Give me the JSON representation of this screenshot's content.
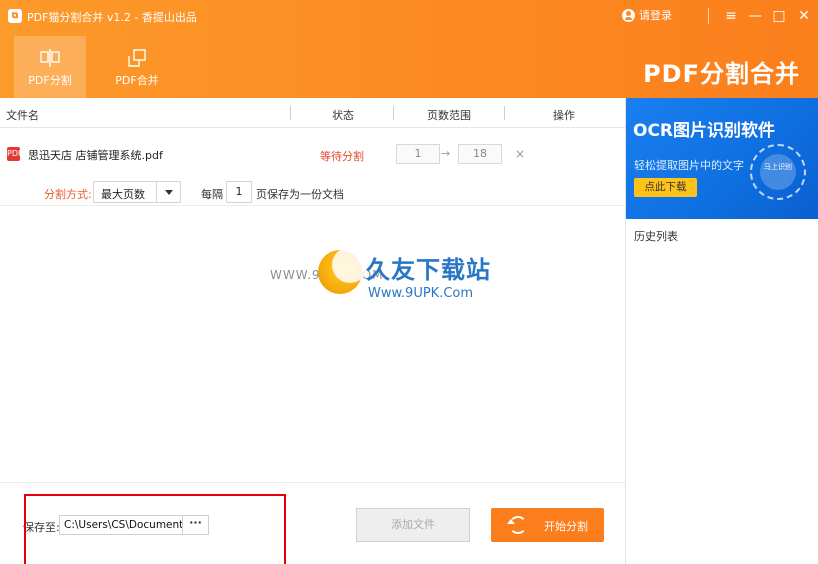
{
  "app": {
    "title": "PDF猫分割合并 v1.2 - 香提山出品",
    "icon_glyph": "⧉",
    "login": "请登录",
    "brand": "PDF分割合并"
  },
  "window_controls": {
    "menu": "≡",
    "minimize": "—",
    "maximize": "□",
    "close": "✕"
  },
  "tabs": [
    {
      "label": "PDF分割",
      "icon": "split-icon",
      "active": true
    },
    {
      "label": "PDF合并",
      "icon": "merge-icon",
      "active": false
    }
  ],
  "table": {
    "headers": {
      "name": "文件名",
      "status": "状态",
      "range": "页数范围",
      "ops": "操作"
    },
    "rows": [
      {
        "file_icon": "PDF",
        "name": "思迅天店 店铺管理系统.pdf",
        "status": "等待分割",
        "range_from": "1",
        "range_arrow": "→",
        "range_to": "18",
        "delete": "×"
      }
    ]
  },
  "split_options": {
    "label": "分割方式:",
    "mode": "最大页数",
    "every_label": "每隔",
    "every_value": "1",
    "suffix": "页保存为一份文档"
  },
  "watermark": {
    "left": "WWW.9UPK.COM",
    "main": "久友下载站",
    "url": "Www.9UPK.Com"
  },
  "bottom": {
    "save_label": "保存至:",
    "save_path": "C:\\Users\\CS\\Document",
    "browse": "···",
    "add_files": "添加文件",
    "start": "开始分割"
  },
  "sidebar": {
    "ad_title": "OCR图片识别软件",
    "ad_subtitle": "轻松提取图片中的文字",
    "ad_button": "点此下载",
    "ad_circle_text": "马上识别",
    "history_label": "历史列表"
  },
  "colors": {
    "brand_orange": "#fb8a22",
    "status_red": "#e8472f",
    "ad_blue": "#1a7ff0",
    "highlight_red": "#e3000b"
  }
}
